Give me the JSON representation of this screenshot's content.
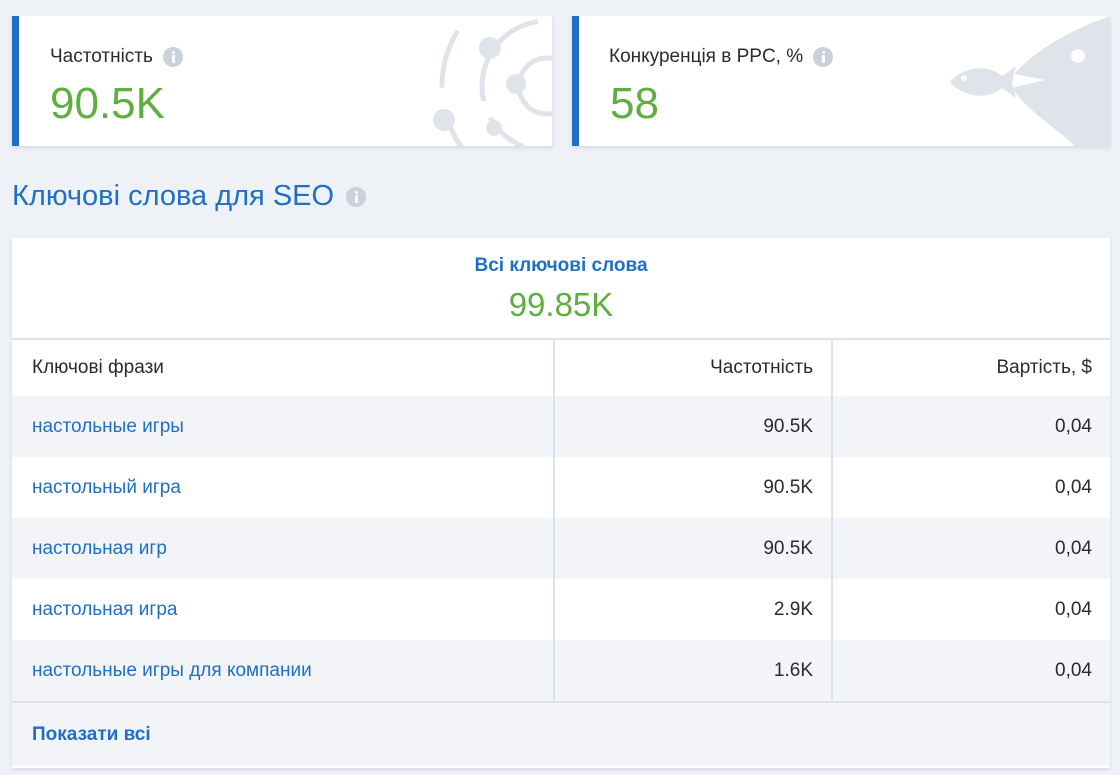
{
  "metrics": [
    {
      "label": "Частотність",
      "value": "90.5K",
      "icon": "info-icon"
    },
    {
      "label": "Конкуренція в PPC, %",
      "value": "58",
      "icon": "info-icon"
    }
  ],
  "section": {
    "title": "Ключові слова для SEO",
    "icon": "info-icon"
  },
  "summary": {
    "label": "Всі ключові слова",
    "value": "99.85K"
  },
  "table": {
    "headers": [
      "Ключові фрази",
      "Частотність",
      "Вартість, $"
    ],
    "rows": [
      {
        "phrase": "настольные игры",
        "frequency": "90.5K",
        "cost": "0,04"
      },
      {
        "phrase": "настольный игра",
        "frequency": "90.5K",
        "cost": "0,04"
      },
      {
        "phrase": "настольная игр",
        "frequency": "90.5K",
        "cost": "0,04"
      },
      {
        "phrase": "настольная игра",
        "frequency": "2.9K",
        "cost": "0,04"
      },
      {
        "phrase": "настольные игры для компании",
        "frequency": "1.6K",
        "cost": "0,04"
      }
    ]
  },
  "footer": {
    "show_all_label": "Показати всі"
  },
  "colors": {
    "accent": "#1f6fc5",
    "value_green": "#5fae3e",
    "background": "#eef1f6",
    "decoration": "#c9d1dc"
  }
}
